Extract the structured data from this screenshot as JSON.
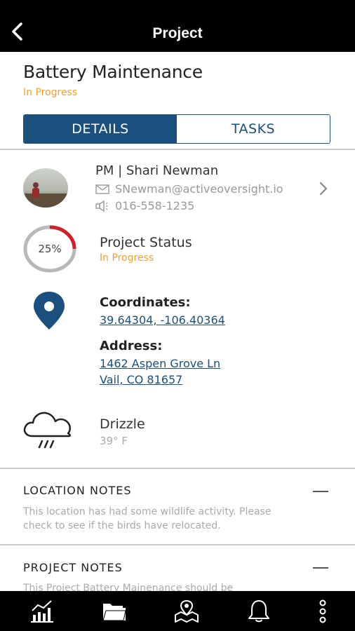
{
  "header": {
    "title": "Project",
    "back_label": ""
  },
  "project": {
    "title": "Battery Maintenance",
    "status": "In Progress"
  },
  "tabs": [
    {
      "label": "DETAILS",
      "active": true
    },
    {
      "label": "TASKS",
      "active": false
    }
  ],
  "manager": {
    "name": "PM | Shari Newman",
    "email": "SNewman@activeoversight.io",
    "phone": "016-558-1235"
  },
  "status_block": {
    "percent_text": "25%",
    "progress": 0.25,
    "label": "Project Status",
    "value": "In Progress"
  },
  "location": {
    "coord_label": "Coordinates:",
    "coordinates": "39.64304, -106.40364",
    "address_label": "Address:",
    "address_line1": "1462 Aspen Grove Ln",
    "address_line2": "Vail, CO 81657"
  },
  "weather": {
    "condition": "Drizzle",
    "temperature": "39° F"
  },
  "location_notes": {
    "heading": "LOCATION NOTES",
    "line1": "This location has had some wildlife activity. Please",
    "line2": "check to see if the birds have relocated."
  },
  "project_notes": {
    "heading": "PROJECT NOTES",
    "line1": "This Project Battery Mainenance should be"
  },
  "colors": {
    "accent": "#1b4f7e",
    "status": "#f0a030",
    "ring": "#d0202a"
  },
  "bottom_nav": [
    "chart-icon",
    "folder-icon",
    "map-icon",
    "bell-icon",
    "more-icon"
  ]
}
